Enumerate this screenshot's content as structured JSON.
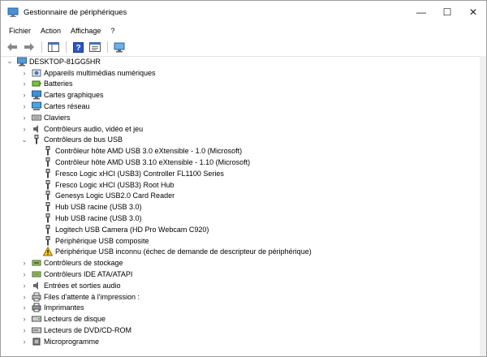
{
  "window": {
    "title": "Gestionnaire de périphériques",
    "minimize": "—",
    "maximize": "☐",
    "close": "✕"
  },
  "menu": {
    "file": "Fichier",
    "action": "Action",
    "view": "Affichage",
    "help": "?"
  },
  "tree": {
    "root": "DESKTOP-81GG5HR",
    "categories": [
      {
        "label": "Appareils multimédias numériques",
        "icon": "multimedia-icon"
      },
      {
        "label": "Batteries",
        "icon": "battery-icon"
      },
      {
        "label": "Cartes graphiques",
        "icon": "display-adapter-icon"
      },
      {
        "label": "Cartes réseau",
        "icon": "network-adapter-icon"
      },
      {
        "label": "Claviers",
        "icon": "keyboard-icon"
      },
      {
        "label": "Contrôleurs audio, vidéo et jeu",
        "icon": "speaker-icon"
      },
      {
        "label": "Contrôleurs de bus USB",
        "icon": "usb-icon",
        "expanded": true
      }
    ],
    "usb_children": [
      "Contrôleur hôte AMD USB 3.0 eXtensible - 1.0 (Microsoft)",
      "Contrôleur hôte AMD USB 3.10 eXtensible - 1.10 (Microsoft)",
      "Fresco Logic xHCI (USB3) Controller FL1100 Series",
      "Fresco Logic xHCI (USB3) Root Hub",
      "Genesys Logic USB2.0 Card Reader",
      "Hub USB racine (USB 3.0)",
      "Hub USB racine (USB 3.0)",
      "Logitech USB Camera (HD Pro Webcam C920)",
      "Périphérique USB composite",
      "Périphérique USB inconnu (échec de demande de descripteur de périphérique)"
    ],
    "more_categories": [
      {
        "label": "Contrôleurs de stockage",
        "icon": "storage-controller-icon"
      },
      {
        "label": "Contrôleurs IDE ATA/ATAPI",
        "icon": "ide-controller-icon"
      },
      {
        "label": "Entrées et sorties audio",
        "icon": "audio-io-icon"
      },
      {
        "label": "Files d'attente à l'impression :",
        "icon": "print-queue-icon"
      },
      {
        "label": "Imprimantes",
        "icon": "printer-icon"
      },
      {
        "label": "Lecteurs de disque",
        "icon": "disk-drive-icon"
      },
      {
        "label": "Lecteurs de DVD/CD-ROM",
        "icon": "dvd-drive-icon"
      },
      {
        "label": "Microprogramme",
        "icon": "firmware-icon"
      }
    ]
  }
}
